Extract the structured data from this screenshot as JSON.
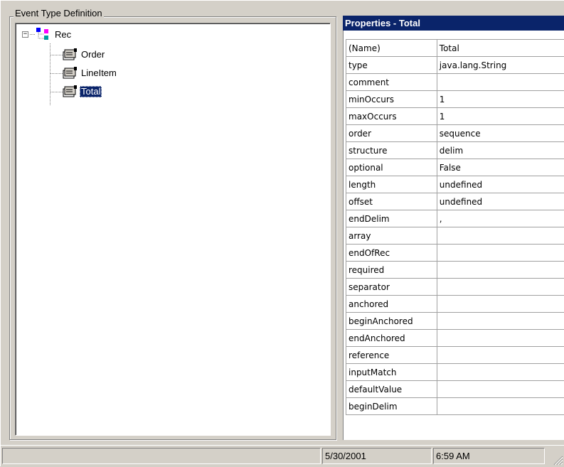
{
  "group": {
    "title": "Event Type Definition"
  },
  "tree": {
    "expander": "−",
    "root": {
      "label": "Rec",
      "icon": "record-structure-icon"
    },
    "children": [
      {
        "label": "Order",
        "icon": "field-property-icon",
        "selected": false
      },
      {
        "label": "LineItem",
        "icon": "field-property-icon",
        "selected": false
      },
      {
        "label": "Total",
        "icon": "field-property-icon",
        "selected": true
      }
    ]
  },
  "properties": {
    "header": "Properties - Total",
    "rows": [
      {
        "name": "(Name)",
        "value": "Total"
      },
      {
        "name": "type",
        "value": "java.lang.String"
      },
      {
        "name": "comment",
        "value": ""
      },
      {
        "name": "minOccurs",
        "value": "1"
      },
      {
        "name": "maxOccurs",
        "value": "1"
      },
      {
        "name": "order",
        "value": "sequence"
      },
      {
        "name": "structure",
        "value": "delim"
      },
      {
        "name": "optional",
        "value": "False"
      },
      {
        "name": "length",
        "value": "undefined"
      },
      {
        "name": "offset",
        "value": "undefined"
      },
      {
        "name": "endDelim",
        "value": ","
      },
      {
        "name": "array",
        "value": ""
      },
      {
        "name": "endOfRec",
        "value": ""
      },
      {
        "name": "required",
        "value": ""
      },
      {
        "name": "separator",
        "value": ""
      },
      {
        "name": "anchored",
        "value": ""
      },
      {
        "name": "beginAnchored",
        "value": ""
      },
      {
        "name": "endAnchored",
        "value": ""
      },
      {
        "name": "reference",
        "value": ""
      },
      {
        "name": "inputMatch",
        "value": ""
      },
      {
        "name": "defaultValue",
        "value": ""
      },
      {
        "name": "beginDelim",
        "value": ""
      }
    ]
  },
  "status": {
    "main": "",
    "date": "5/30/2001",
    "time": "6:59 AM"
  },
  "colors": {
    "face": "#d4d0c8",
    "selection": "#0a246a",
    "header": "#0a246a"
  }
}
